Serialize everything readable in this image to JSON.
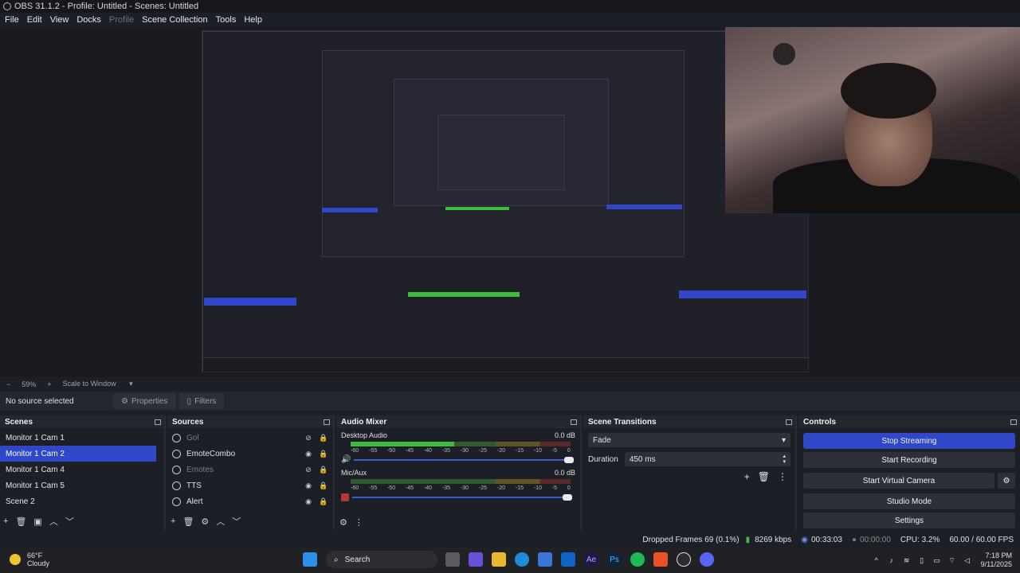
{
  "window": {
    "title": "OBS 31.1.2 - Profile: Untitled - Scenes: Untitled"
  },
  "menu": [
    {
      "label": "File",
      "disabled": false
    },
    {
      "label": "Edit",
      "disabled": false
    },
    {
      "label": "View",
      "disabled": false
    },
    {
      "label": "Docks",
      "disabled": false
    },
    {
      "label": "Profile",
      "disabled": true
    },
    {
      "label": "Scene Collection",
      "disabled": false
    },
    {
      "label": "Tools",
      "disabled": false
    },
    {
      "label": "Help",
      "disabled": false
    }
  ],
  "zoom": {
    "minus": "−",
    "value": "59%",
    "plus": "+",
    "mode": "Scale to Window"
  },
  "source_toolbar": {
    "label": "No source selected",
    "properties": "Properties",
    "filters": "Filters"
  },
  "scenes": {
    "title": "Scenes",
    "items": [
      "Monitor 1 Cam 1",
      "Monitor 1 Cam 2",
      "Monitor 1 Cam 4",
      "Monitor 1 Cam 5",
      "Scene 2"
    ],
    "selected_index": 1
  },
  "sources": {
    "title": "Sources",
    "items": [
      {
        "name": "Gol",
        "visible": false
      },
      {
        "name": "EmoteCombo",
        "visible": true
      },
      {
        "name": "Emotes",
        "visible": false
      },
      {
        "name": "TTS",
        "visible": true
      },
      {
        "name": "Alert",
        "visible": true
      }
    ]
  },
  "mixer": {
    "title": "Audio Mixer",
    "channels": [
      {
        "name": "Desktop Audio",
        "db": "0.0 dB",
        "level": 0.47
      },
      {
        "name": "Mic/Aux",
        "db": "0.0 dB",
        "level": 0.0
      }
    ],
    "ticks": [
      "-60",
      "-55",
      "-50",
      "-45",
      "-40",
      "-35",
      "-30",
      "-25",
      "-20",
      "-15",
      "-10",
      "-5",
      "0"
    ]
  },
  "transitions": {
    "title": "Scene Transitions",
    "type": "Fade",
    "duration_label": "Duration",
    "duration_value": "450 ms"
  },
  "controls": {
    "title": "Controls",
    "stop_streaming": "Stop Streaming",
    "start_recording": "Start Recording",
    "start_virtual_camera": "Start Virtual Camera",
    "studio_mode": "Studio Mode",
    "settings": "Settings"
  },
  "status": {
    "dropped": "Dropped Frames 69 (0.1%)",
    "bitrate": "8269 kbps",
    "stream_time": "00:33:03",
    "rec_time": "00:00:00",
    "cpu": "CPU: 3.2%",
    "fps": "60.00 / 60.00 FPS"
  },
  "taskbar": {
    "temp": "66°F",
    "weather": "Cloudy",
    "search": "Search",
    "time": "7:18 PM",
    "date": "9/11/2025"
  },
  "colors": {
    "accent": "#2f47c8",
    "meter_green": "#3fbb3f",
    "meter_yellow": "#b9a535",
    "meter_red": "#b13939"
  }
}
